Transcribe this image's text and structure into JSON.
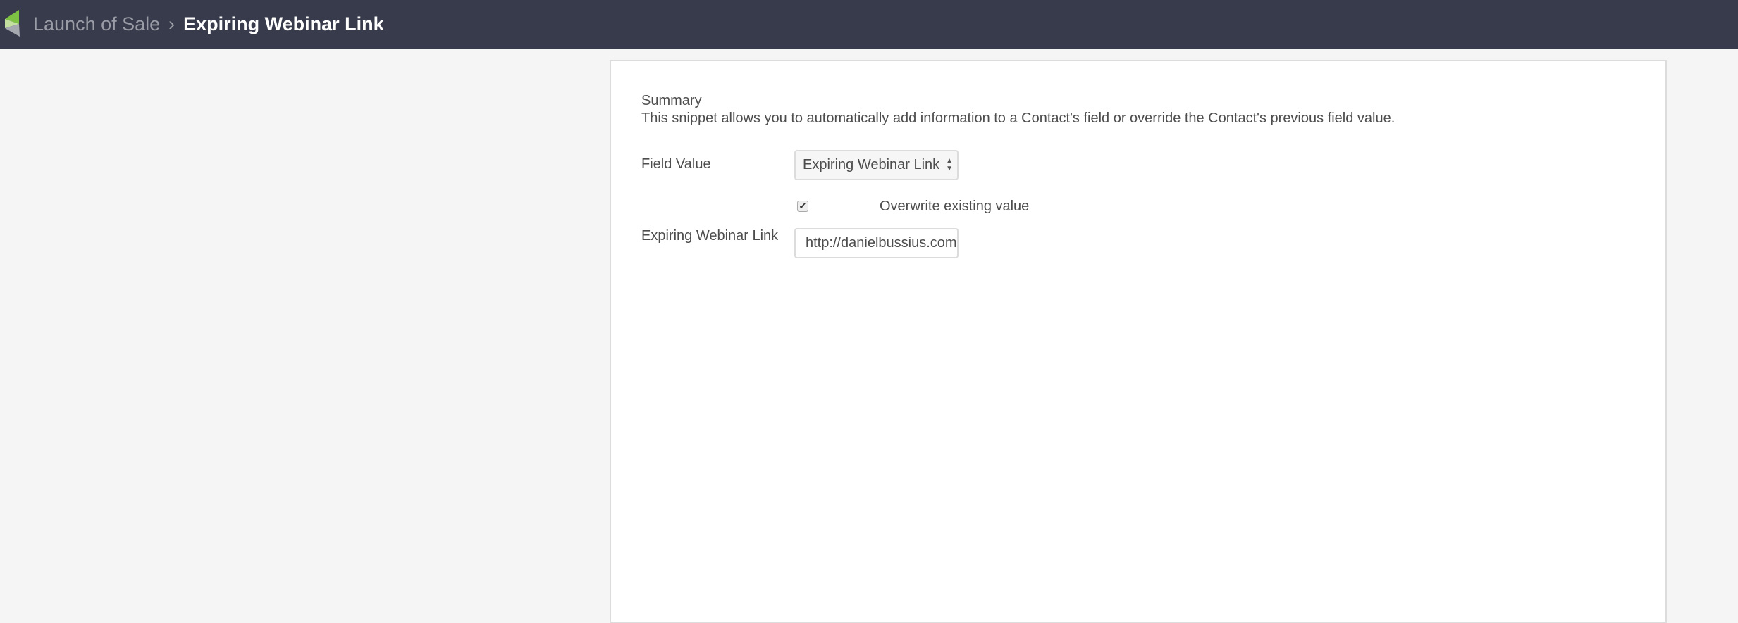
{
  "header": {
    "breadcrumb_parent": "Launch of Sale",
    "breadcrumb_separator": "›",
    "breadcrumb_current": "Expiring Webinar Link",
    "logo_colors": [
      "#7dc242",
      "#c3e0a0",
      "#a7a9b0"
    ]
  },
  "form": {
    "summary_title": "Summary",
    "summary_text": "This snippet allows you to automatically add information to a Contact's field or override the Contact's previous field value.",
    "field_value_label": "Field Value",
    "field_value_selected": "Expiring Webinar Link",
    "overwrite_label": "Overwrite existing value",
    "overwrite_checked": true,
    "link_label": "Expiring Webinar Link",
    "link_value": "http://danielbussius.com/marke"
  }
}
